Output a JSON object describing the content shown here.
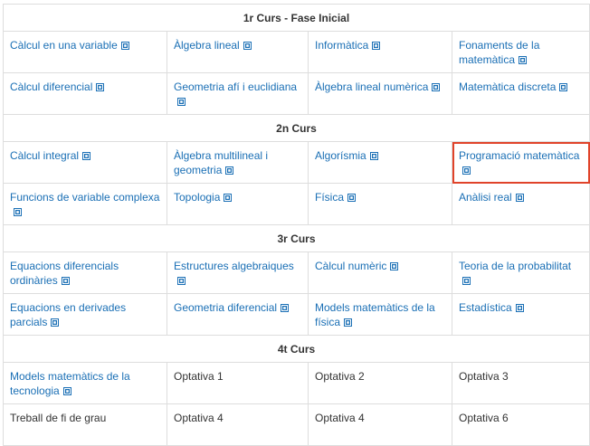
{
  "accent_link": "#1a6fb5",
  "highlight_color": "#e0432a",
  "link_icon": "external-link-icon",
  "sections": [
    {
      "title": "1r Curs - Fase Inicial",
      "rows": [
        [
          {
            "label": "Càlcul en una variable",
            "link": true
          },
          {
            "label": "Àlgebra lineal",
            "link": true
          },
          {
            "label": "Informàtica",
            "link": true
          },
          {
            "label": "Fonaments de la matemàtica",
            "link": true
          }
        ],
        [
          {
            "label": "Càlcul diferencial",
            "link": true
          },
          {
            "label": "Geometria afí i euclidiana",
            "link": true
          },
          {
            "label": "Àlgebra lineal numèrica",
            "link": true
          },
          {
            "label": "Matemàtica discreta",
            "link": true
          }
        ]
      ]
    },
    {
      "title": "2n Curs",
      "rows": [
        [
          {
            "label": "Càlcul integral",
            "link": true
          },
          {
            "label": "Àlgebra multilineal i geometria",
            "link": true
          },
          {
            "label": "Algorísmia",
            "link": true
          },
          {
            "label": "Programació matemàtica",
            "link": true,
            "highlighted": true
          }
        ],
        [
          {
            "label": "Funcions de variable complexa",
            "link": true
          },
          {
            "label": "Topologia",
            "link": true
          },
          {
            "label": "Física",
            "link": true
          },
          {
            "label": "Anàlisi real",
            "link": true
          }
        ]
      ]
    },
    {
      "title": "3r Curs",
      "rows": [
        [
          {
            "label": "Equacions diferencials ordinàries",
            "link": true
          },
          {
            "label": "Estructures algebraiques",
            "link": true
          },
          {
            "label": "Càlcul numèric",
            "link": true
          },
          {
            "label": "Teoria de la probabilitat",
            "link": true
          }
        ],
        [
          {
            "label": "Equacions en derivades parcials",
            "link": true
          },
          {
            "label": "Geometria diferencial",
            "link": true
          },
          {
            "label": "Models matemàtics de la física",
            "link": true
          },
          {
            "label": "Estadística",
            "link": true
          }
        ]
      ]
    },
    {
      "title": "4t Curs",
      "rows": [
        [
          {
            "label": "Models matemàtics de la tecnologia",
            "link": true
          },
          {
            "label": "Optativa 1",
            "link": false
          },
          {
            "label": "Optativa 2",
            "link": false
          },
          {
            "label": "Optativa 3",
            "link": false
          }
        ],
        [
          {
            "label": "Treball de fi de grau",
            "link": false
          },
          {
            "label": "Optativa 4",
            "link": false
          },
          {
            "label": "Optativa 4",
            "link": false
          },
          {
            "label": "Optativa 6",
            "link": false
          }
        ]
      ]
    }
  ]
}
